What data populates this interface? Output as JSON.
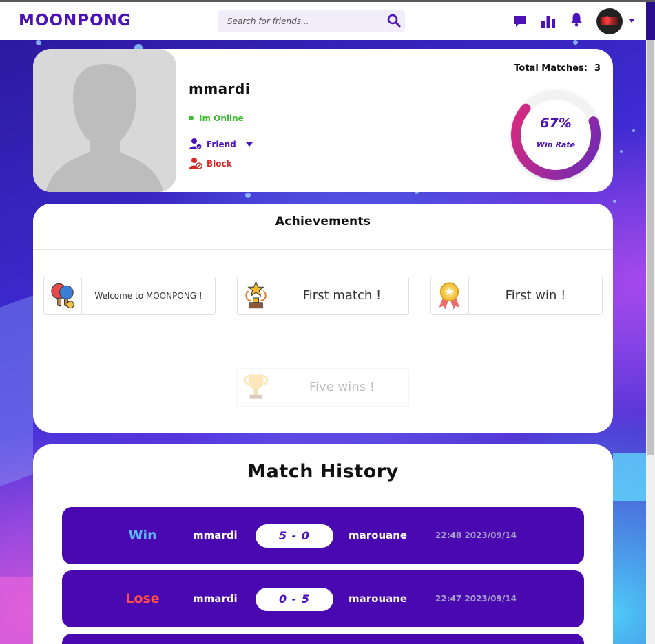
{
  "navbar": {
    "logo": "MOONPONG",
    "search_placeholder": "Search for friends..."
  },
  "profile": {
    "username": "mmardi",
    "status": "Im Online",
    "friend_label": "Friend",
    "block_label": "Block",
    "total_matches_label": "Total Matches:",
    "total_matches": "3",
    "win_rate_value": 67,
    "win_rate_text": "67%",
    "win_rate_label": "Win Rate"
  },
  "achievements": {
    "title": "Achievements",
    "items": [
      {
        "label": "Welcome to MOONPONG !",
        "icon": "ping-pong-paddles-icon",
        "unlocked": true
      },
      {
        "label": "First match !",
        "icon": "star-trophy-icon",
        "unlocked": true
      },
      {
        "label": "First win !",
        "icon": "medal-icon",
        "unlocked": true
      },
      {
        "label": "Five wins !",
        "icon": "trophy-cup-icon",
        "unlocked": false
      }
    ]
  },
  "match_history": {
    "title": "Match History",
    "matches": [
      {
        "result": "Win",
        "player1": "mmardi",
        "score": "5 - 0",
        "player2": "marouane",
        "time": "22:48 2023/09/14"
      },
      {
        "result": "Lose",
        "player1": "mmardi",
        "score": "0 - 5",
        "player2": "marouane",
        "time": "22:47 2023/09/14"
      }
    ]
  },
  "colors": {
    "brand": "#4a12b8",
    "win": "#5fb8ff",
    "lose": "#ff4d4d",
    "online": "#3bbf2e",
    "block": "#d42a2a"
  }
}
